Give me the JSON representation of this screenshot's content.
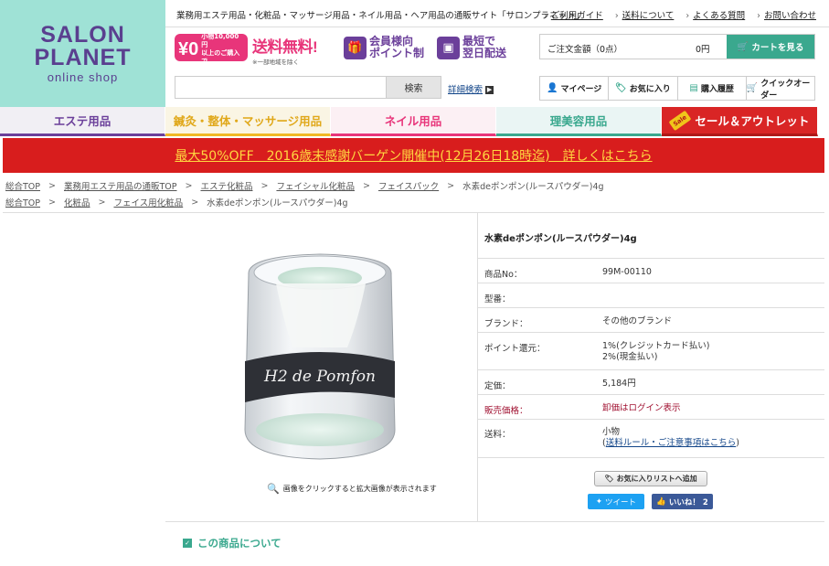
{
  "logo": {
    "line1": "SALON",
    "line2": "PLANET",
    "line3": "online shop"
  },
  "header": {
    "tagline": "業務用エステ用品・化粧品・マッサージ用品・ネイル用品・ヘア用品の通販サイト「サロンプラネット」",
    "links": [
      "ご利用ガイド",
      "送料について",
      "よくある質問",
      "お問い合わせ"
    ]
  },
  "promos": {
    "free_zero": "¥0",
    "free_small": "小物10,000円\n以上のご購入で",
    "shipping_title": "送料無料!",
    "shipping_note": "※一部地域を除く",
    "points_line1": "会員様向",
    "points_line2": "ポイント制",
    "delivery_line1": "最短で",
    "delivery_line2": "翌日配送"
  },
  "cart": {
    "label": "ご注文金額（0点）",
    "amount": "0円",
    "button": "カートを見る"
  },
  "search": {
    "placeholder": "",
    "button": "検索",
    "advanced": "詳細検索"
  },
  "user_nav": [
    "マイページ",
    "お気に入り",
    "購入履歴",
    "クイックオーダー"
  ],
  "categories": [
    "エステ用品",
    "鍼灸・整体・マッサージ用品",
    "ネイル用品",
    "理美容用品",
    "セール＆アウトレット"
  ],
  "sale_tag": "Sale",
  "banner": "最大50%OFF　2016歳末感謝バーゲン開催中(12月26日18時迄)　詳しくはこちら",
  "breadcrumbs": {
    "row1": [
      "総合TOP",
      "業務用エステ用品の通販TOP",
      "エステ化粧品",
      "フェイシャル化粧品",
      "フェイスパック",
      "水素deポンポン(ルースパウダー)4g"
    ],
    "row2": [
      "総合TOP",
      "化粧品",
      "フェイス用化粧品",
      "水素deポンポン(ルースパウダー)4g"
    ]
  },
  "product": {
    "title": "水素deポンポン(ルースパウダー)4g",
    "image_label": "H2 de Pomfon",
    "zoom_note": "画像をクリックすると拡大画像が表示されます",
    "specs": [
      {
        "label": "商品No：",
        "value": "99M-00110"
      },
      {
        "label": "型番：",
        "value": ""
      },
      {
        "label": "ブランド：",
        "value": "その他のブランド"
      },
      {
        "label": "ポイント還元：",
        "value_line1": "1%(クレジットカード払い)",
        "value_line2": "2%(現金払い)"
      },
      {
        "label": "定価：",
        "value": "5,184円"
      },
      {
        "label": "販売価格：",
        "value": "卸価はログイン表示"
      },
      {
        "label": "送料：",
        "value_line1": "小物",
        "value_link": "送料ルール・ご注意事項はこちら"
      }
    ],
    "fav_button": "お気に入りリストへ追加",
    "tweet": "ツイート",
    "like": "いいね！ 2"
  },
  "section": {
    "about": "この商品について"
  },
  "colors": {
    "brand_purple": "#5a3f8f",
    "teal": "#3aa88e",
    "pink": "#e8357a",
    "red": "#d81d1d",
    "yellow_link": "#ffd740"
  }
}
